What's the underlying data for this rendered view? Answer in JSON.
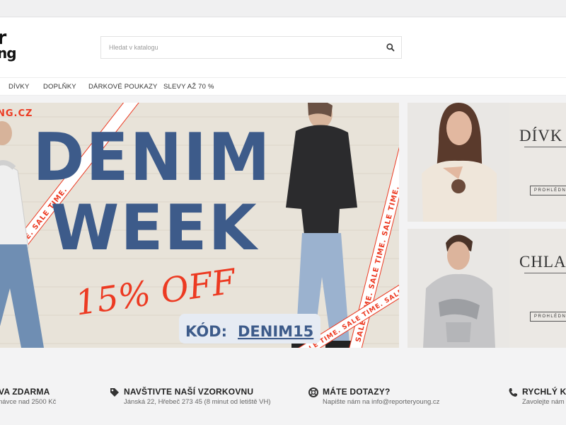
{
  "logo": {
    "line1": "r",
    "line2": "ng"
  },
  "search": {
    "placeholder": "Hledat v katalogu",
    "icon": "search-icon"
  },
  "nav": {
    "items": [
      {
        "label": "DÍVKY"
      },
      {
        "label": "DOPLŇKY"
      },
      {
        "label": "DÁRKOVÉ POUKAZY"
      },
      {
        "label": "SLEVY AŽ 70 %"
      }
    ]
  },
  "hero": {
    "site": "NG.CZ",
    "headline1": "DENIM",
    "headline2": "WEEK",
    "offer": "15% OFF",
    "code_label": "KÓD:",
    "code": "DENIM15",
    "tape_text": "SALE TIME. SALE TIME. SALE TIME.",
    "colors": {
      "headline": "#3d5b8a",
      "offer": "#ec3a22",
      "tape": "#ec3a22",
      "background": "#e6e1d6"
    }
  },
  "tiles": [
    {
      "title": "DÍVK",
      "button": "PROHLÉDN"
    },
    {
      "title": "CHLA",
      "button": "PROHLÉDN"
    }
  ],
  "benefits": [
    {
      "title": "VA ZDARMA",
      "subtitle": "návce nad 2500 Kč",
      "icon": ""
    },
    {
      "title": "NAVŠTIVTE NAŠÍ VZORKOVNU",
      "subtitle": "Jánská 22, Hřebeč 273 45 (8 minut od letiště VH)",
      "icon": "tag-icon"
    },
    {
      "title": "MÁTE DOTAZY?",
      "subtitle": "Napište nám na info@reporteryoung.cz",
      "icon": "lifebuoy-icon"
    },
    {
      "title": "RYCHLÝ KO",
      "subtitle": "Zavolejte nám",
      "icon": "phone-icon"
    }
  ]
}
